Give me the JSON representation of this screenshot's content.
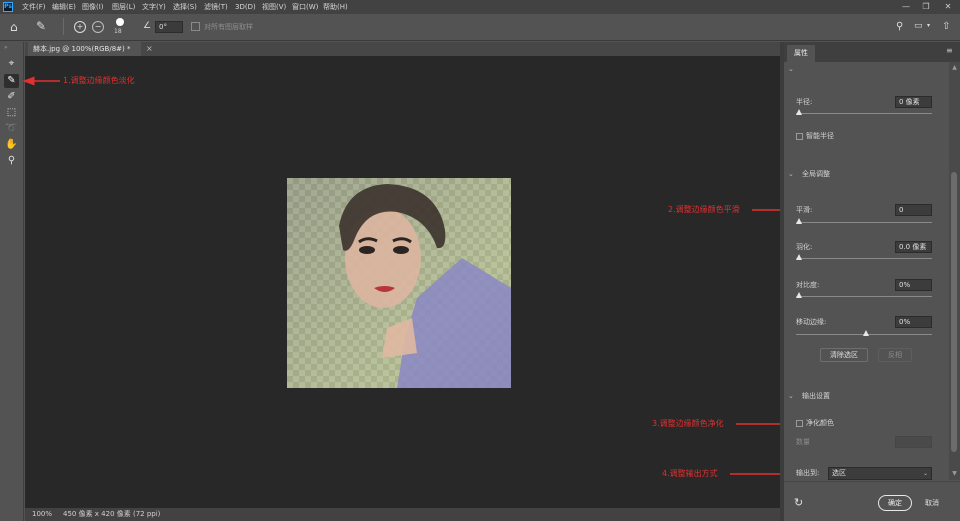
{
  "menubar": {
    "logo": "Ps",
    "items": [
      "文件(F)",
      "编辑(E)",
      "图像(I)",
      "图层(L)",
      "文字(Y)",
      "选择(S)",
      "滤镜(T)",
      "3D(D)",
      "视图(V)",
      "窗口(W)",
      "帮助(H)"
    ]
  },
  "window_controls": {
    "minimize": "—",
    "restore": "❐",
    "close": "✕"
  },
  "options_bar": {
    "brush_size": "18",
    "angle_value": "0°",
    "sample_all_layers_label": "对所有图层取样"
  },
  "document": {
    "tab_title": "赫本.jpg @ 100%(RGB/8#) *",
    "tab_close": "×"
  },
  "status": {
    "zoom": "100%",
    "info": "450 像素 x 420 像素 (72 ppi)"
  },
  "annotations": {
    "a1": "1.调整边缘颜色淡化",
    "a2": "2.调整边缘颜色平滑",
    "a3": "3.调整边缘颜色净化",
    "a4": "4.调整输出方式"
  },
  "panel": {
    "tab_label": "属性",
    "radius_label": "半径:",
    "radius_value": "0 像素",
    "smart_radius_label": "智能半径",
    "global_section": "全局调整",
    "smooth_label": "平滑:",
    "smooth_value": "0",
    "feather_label": "羽化:",
    "feather_value": "0.0 像素",
    "contrast_label": "对比度:",
    "contrast_value": "0%",
    "shift_edge_label": "移动边缘:",
    "shift_edge_value": "0%",
    "clear_selection_label": "清除选区",
    "invert_label": "反相",
    "output_section": "输出设置",
    "decontaminate_label": "净化颜色",
    "amount_label": "数量",
    "output_to_label": "输出到:",
    "output_to_value": "选区",
    "ok_label": "确定",
    "cancel_label": "取消"
  },
  "colors": {
    "annotation": "#e23030",
    "canvas_bg": "#282828",
    "panel_bg": "#535353"
  }
}
